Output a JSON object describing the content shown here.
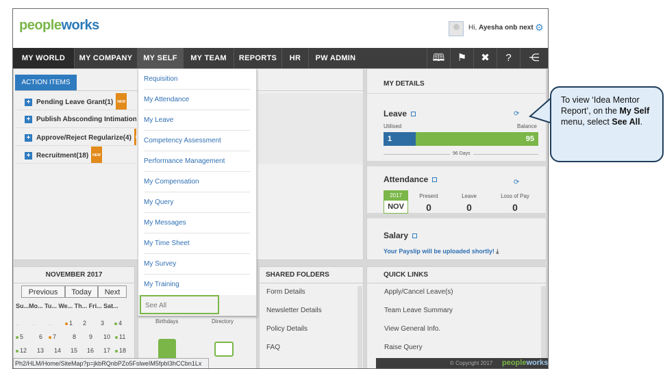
{
  "header": {
    "logo_part1": "people",
    "logo_part2": "works",
    "greeting": "Hi,",
    "user_name": "Ayesha onb next"
  },
  "nav": {
    "items": [
      "MY WORLD",
      "MY COMPANY",
      "MY SELF",
      "MY TEAM",
      "REPORTS",
      "HR",
      "PW ADMIN"
    ],
    "active": "MY WORLD",
    "open": "MY SELF"
  },
  "action_items": {
    "tab_label": "ACTION ITEMS",
    "rows": [
      {
        "label": "Pending Leave Grant",
        "count": "(1)"
      },
      {
        "label": "Publish Absconding Intimation L",
        "count": ""
      },
      {
        "label": "Approve/Reject Regularize",
        "count": "(4)"
      },
      {
        "label": "Recruitment",
        "count": "(18)"
      }
    ],
    "new_badge": "NEW"
  },
  "dropdown": {
    "items": [
      "Requisition",
      "My Attendance",
      "My Leave",
      "Competency Assessment",
      "Performance Management",
      "My Compensation",
      "My Query",
      "My Messages",
      "My Time Sheet",
      "My Survey",
      "My Training"
    ],
    "see_all": "See All"
  },
  "my_details": {
    "title": "MY DETAILS",
    "leave": {
      "label": "Leave",
      "utilised_label": "Utilised",
      "balance_label": "Balance",
      "utilised": "1",
      "balance": "95",
      "total": "96 Days",
      "utilised_fraction": 0.21
    },
    "attendance": {
      "label": "Attendance",
      "year": "2017",
      "month": "NOV",
      "present_label": "Present",
      "present": "0",
      "leave_label": "Leave",
      "leave": "0",
      "lop_label": "Loss of Pay",
      "lop": "0"
    },
    "salary": {
      "label": "Salary",
      "payslip_text": "Your Payslip will be uploaded shortly!"
    }
  },
  "calendar": {
    "title": "NOVEMBER 2017",
    "prev": "Previous",
    "today": "Today",
    "next": "Next",
    "weekdays": "Su...Mo... Tu... We... Th... Fri... Sat...",
    "row1": [
      "",
      "",
      "",
      "1",
      "2",
      "3",
      "4"
    ],
    "row2": [
      "5",
      "6",
      "7",
      "8",
      "9",
      "10",
      "11"
    ],
    "row3": [
      "12",
      "13",
      "14",
      "15",
      "16",
      "17",
      "18"
    ]
  },
  "widgets": {
    "birthdays": "Birthdays",
    "directory": "Directory"
  },
  "shared_folders": {
    "title": "SHARED FOLDERS",
    "items": [
      "Form Details",
      "Newsletter Details",
      "Policy Details",
      "FAQ"
    ]
  },
  "quick_links": {
    "title": "QUICK LINKS",
    "items": [
      "Apply/Cancel Leave(s)",
      "Team Leave Summary",
      "View General Info.",
      "Raise Query"
    ]
  },
  "status_bar": "Ph2/HLM/Home/SiteMap?p=jkbRQnbPZo5FslweIM5fpbI3hCCbn1Lx",
  "footer": {
    "copyright": "© Copyright 2017"
  },
  "callout": {
    "line1": "To view ‘Idea Mentor Report’, on the",
    "menu_name": "My Self",
    "line2": " menu, select",
    "action": "See All",
    "line3": "."
  },
  "colors": {
    "nav_bg": "#3d3d3d",
    "brand_blue": "#2f7bbf",
    "brand_green": "#7ab648",
    "new_badge": "#e28a1a",
    "callout_bg": "#e0ecf7",
    "callout_border": "#1f3d5c"
  },
  "icons": [
    "settings-icon",
    "book-icon",
    "flag-icon",
    "tools-icon",
    "help-icon",
    "sitemap-icon",
    "refresh-icon",
    "download-icon",
    "plus-icon"
  ]
}
